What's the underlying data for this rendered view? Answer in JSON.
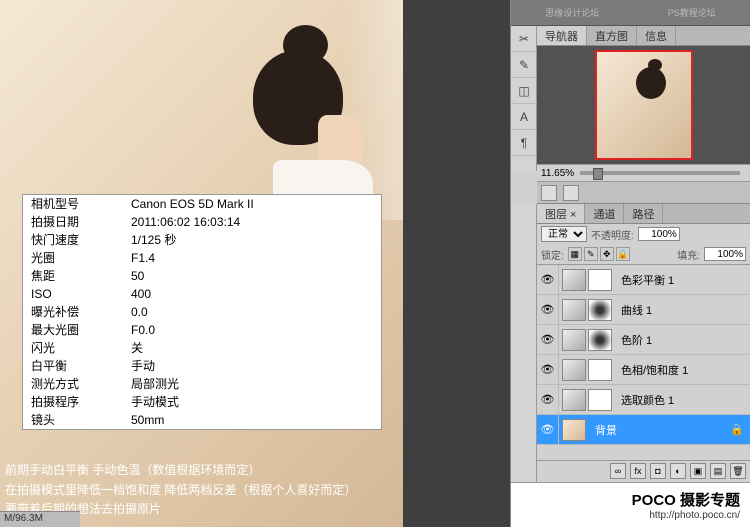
{
  "watermark": {
    "left": "思缘设计论坛",
    "right": "PS教程论坛"
  },
  "exif": {
    "rows": [
      {
        "label": "相机型号",
        "value": "Canon EOS 5D Mark II"
      },
      {
        "label": "拍摄日期",
        "value": "2011:06:02 16:03:14"
      },
      {
        "label": "快门速度",
        "value": "1/125 秒"
      },
      {
        "label": "光圈",
        "value": "F1.4"
      },
      {
        "label": "焦距",
        "value": "50"
      },
      {
        "label": "ISO",
        "value": "400"
      },
      {
        "label": "曝光补偿",
        "value": "0.0"
      },
      {
        "label": "最大光圈",
        "value": "F0.0"
      },
      {
        "label": "闪光",
        "value": "关"
      },
      {
        "label": "白平衡",
        "value": "手动"
      },
      {
        "label": "测光方式",
        "value": "局部测光"
      },
      {
        "label": "拍摄程序",
        "value": "手动模式"
      },
      {
        "label": "镜头",
        "value": "50mm"
      }
    ]
  },
  "bottom_notes": {
    "line1": "前期手动白平衡 手动色温（数值根据环境而定）",
    "line2": "在拍摄模式里降低一档饱和度 降低两档反差（根据个人喜好而定）",
    "line3": "要带着后期的想法去拍摄原片"
  },
  "status": "M/96.3M",
  "navigator": {
    "tabs": {
      "nav": "导航器",
      "hist": "直方图",
      "info": "信息"
    },
    "zoom": "11.65%"
  },
  "layers_panel": {
    "tabs": {
      "layers": "图层 ×",
      "channels": "通道",
      "paths": "路径"
    },
    "blend_mode": "正常",
    "opacity_label": "不透明度:",
    "opacity_value": "100%",
    "lock_label": "锁定:",
    "fill_label": "填充:",
    "fill_value": "100%",
    "layers": [
      {
        "name": "色彩平衡 1",
        "mask": "plain"
      },
      {
        "name": "曲线 1",
        "mask": "grad"
      },
      {
        "name": "色阶 1",
        "mask": "grad"
      },
      {
        "name": "色相/饱和度 1",
        "mask": "plain"
      },
      {
        "name": "选取颜色 1",
        "mask": "plain"
      }
    ],
    "background_layer": "背景"
  },
  "poco": {
    "logo": "POCO 摄影专题",
    "url": "http://photo.poco.cn/"
  }
}
